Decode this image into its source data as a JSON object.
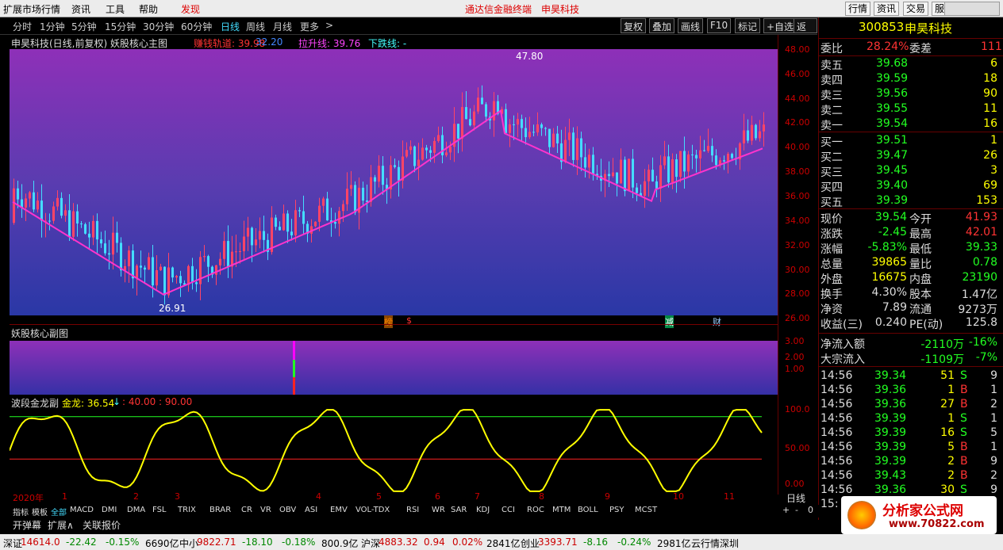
{
  "menubar": {
    "items": [
      "扩展市场行情",
      "资讯",
      "工具",
      "帮助",
      "发现"
    ],
    "center1": "通达信金融终端",
    "center2": "申昊科技",
    "right_buttons": [
      "行情",
      "资讯",
      "交易",
      "服务"
    ]
  },
  "toolbar": {
    "periods": [
      "分时",
      "1分钟",
      "5分钟",
      "15分钟",
      "30分钟",
      "60分钟",
      "日线",
      "周线",
      "月线",
      "更多"
    ],
    "more_arrow": ">",
    "active": "日线",
    "buttons": [
      "复权",
      "叠加",
      "画线",
      "F10",
      "标记",
      "+自选",
      "返回"
    ]
  },
  "main_chart": {
    "title": "申昊科技(日线,前复权) 妖股核心主图",
    "ind1_label": "赚钱轨道: 39.98",
    "ind2_label": "32.20",
    "ind3_label": "拉升线: 39.76",
    "ind4_label": "下跌线: -",
    "high_label": "47.80",
    "low_label": "26.91",
    "badges": [
      "榜",
      "$",
      "减",
      "财"
    ]
  },
  "sub_chart": {
    "title": "妖股核心副图",
    "ticks": [
      "3.00",
      "2.00",
      "1.00"
    ]
  },
  "osc": {
    "title": "波段金龙副",
    "value_label": "金龙: 36.54",
    "arrow": "↓",
    "levels": ": 40.00 : 90.00",
    "ticks": [
      "100.0",
      "50.00",
      "0.00"
    ],
    "xlabels": [
      "2020年",
      "1",
      "2",
      "3",
      "4",
      "5",
      "6",
      "7",
      "8",
      "9",
      "10",
      "11"
    ],
    "period": "日线"
  },
  "price_axis": [
    "48.00",
    "46.00",
    "44.00",
    "42.00",
    "40.00",
    "38.00",
    "36.00",
    "34.00",
    "32.00",
    "30.00",
    "28.00",
    "26.00"
  ],
  "quote": {
    "code": "300853",
    "name": "申昊科技",
    "weibi": {
      "label": "委比",
      "value": "28.24%",
      "label2": "委差",
      "value2": "111"
    },
    "asks": [
      {
        "label": "卖五",
        "price": "39.68",
        "vol": "6"
      },
      {
        "label": "卖四",
        "price": "39.59",
        "vol": "18"
      },
      {
        "label": "卖三",
        "price": "39.56",
        "vol": "90"
      },
      {
        "label": "卖二",
        "price": "39.55",
        "vol": "11"
      },
      {
        "label": "卖一",
        "price": "39.54",
        "vol": "16"
      }
    ],
    "bids": [
      {
        "label": "买一",
        "price": "39.51",
        "vol": "1"
      },
      {
        "label": "买二",
        "price": "39.47",
        "vol": "26"
      },
      {
        "label": "买三",
        "price": "39.45",
        "vol": "3"
      },
      {
        "label": "买四",
        "price": "39.40",
        "vol": "69"
      },
      {
        "label": "买五",
        "price": "39.39",
        "vol": "153"
      }
    ],
    "stats": [
      {
        "l1": "现价",
        "v1": "39.54",
        "l2": "今开",
        "v2": "41.93"
      },
      {
        "l1": "涨跌",
        "v1": "-2.45",
        "l2": "最高",
        "v2": "42.01"
      },
      {
        "l1": "涨幅",
        "v1": "-5.83%",
        "l2": "最低",
        "v2": "39.33"
      },
      {
        "l1": "总量",
        "v1": "39865",
        "l2": "量比",
        "v2": "0.78"
      },
      {
        "l1": "外盘",
        "v1": "16675",
        "l2": "内盘",
        "v2": "23190"
      },
      {
        "l1": "换手",
        "v1": "4.30%",
        "l2": "股本",
        "v2": "1.47亿"
      },
      {
        "l1": "净资",
        "v1": "7.89",
        "l2": "流通",
        "v2": "9273万"
      },
      {
        "l1": "收益(三)",
        "v1": "0.240",
        "l2": "PE(动)",
        "v2": "125.8"
      }
    ],
    "flow": [
      {
        "label": "净流入额",
        "value": "-2110万",
        "pct": "-16%"
      },
      {
        "label": "大宗流入",
        "value": "-1109万",
        "pct": "-7%"
      }
    ],
    "ticks": [
      {
        "t": "14:56",
        "p": "39.34",
        "v": "51",
        "s": "S",
        "n": "9"
      },
      {
        "t": "14:56",
        "p": "39.36",
        "v": "1",
        "s": "B",
        "n": "1"
      },
      {
        "t": "14:56",
        "p": "39.36",
        "v": "27",
        "s": "B",
        "n": "2"
      },
      {
        "t": "14:56",
        "p": "39.39",
        "v": "1",
        "s": "S",
        "n": "1"
      },
      {
        "t": "14:56",
        "p": "39.39",
        "v": "16",
        "s": "S",
        "n": "5"
      },
      {
        "t": "14:56",
        "p": "39.39",
        "v": "5",
        "s": "B",
        "n": "1"
      },
      {
        "t": "14:56",
        "p": "39.39",
        "v": "2",
        "s": "B",
        "n": "9"
      },
      {
        "t": "14:56",
        "p": "39.43",
        "v": "2",
        "s": "B",
        "n": "2"
      },
      {
        "t": "14:56",
        "p": "39.36",
        "v": "30",
        "s": "S",
        "n": "9"
      },
      {
        "t": "15:",
        "p": "",
        "v": "",
        "s": "",
        "n": ""
      }
    ]
  },
  "bottom_tabs": [
    "指标",
    "模板",
    "全部",
    "MACD",
    "DMI",
    "DMA",
    "FSL",
    "TRIX",
    "BRAR",
    "CR",
    "VR",
    "OBV",
    "ASI",
    "EMV",
    "VOL-TDX",
    "RSI",
    "WR",
    "SAR",
    "KDJ",
    "CCI",
    "ROC",
    "MTM",
    "BOLL",
    "PSY",
    "MCST"
  ],
  "bottom_tabs2": [
    "开弹幕",
    "扩展∧",
    "关联报价"
  ],
  "bottom_right": [
    "+",
    "-",
    "0"
  ],
  "statusbar": {
    "items": [
      "深证",
      "14614.0",
      "-22.42",
      "-0.15%",
      "6690亿",
      "中小",
      "9822.71",
      "-18.10",
      "-0.18%",
      "800.9亿",
      "沪深",
      "4883.32",
      "0.94",
      "0.02%",
      "2841亿",
      "创业",
      "3393.71",
      "-8.16",
      "-0.24%",
      "2981亿",
      "云行情深圳"
    ]
  },
  "logo": {
    "text": "分析家公式网",
    "url": "www.70822.com"
  },
  "watermark": "www.70822.Com  分析家公式网",
  "colors": {
    "up": "#ff3333",
    "down": "#22ff22",
    "accent": "#44ddff"
  }
}
